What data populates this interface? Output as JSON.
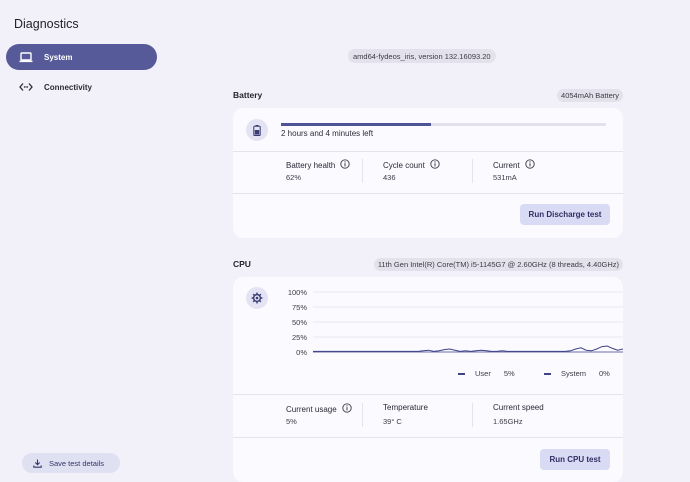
{
  "app": {
    "title": "Diagnostics"
  },
  "sidebar": {
    "items": [
      {
        "label": "System",
        "icon": "laptop-icon",
        "active": true
      },
      {
        "label": "Connectivity",
        "icon": "code-arrows-icon",
        "active": false
      }
    ],
    "save_button": "Save test details"
  },
  "system": {
    "version": "amd64-fydeos_iris, version 132.16093.20"
  },
  "battery": {
    "title": "Battery",
    "chip": "4054mAh Battery",
    "icon": "battery-icon",
    "charge_fraction": 0.46,
    "time_left": "2 hours and 4 minutes left",
    "metrics": [
      {
        "label": "Battery health",
        "value": "62%",
        "info": true
      },
      {
        "label": "Cycle count",
        "value": "436",
        "info": true
      },
      {
        "label": "Current",
        "value": "531mA",
        "info": true
      }
    ],
    "button": "Run Discharge test"
  },
  "cpu": {
    "title": "CPU",
    "chip": "11th Gen Intel(R) Core(TM) i5-1145G7 @ 2.60GHz (8 threads, 4.40GHz)",
    "icon": "settings-gear-icon",
    "legend": [
      {
        "label": "User",
        "value": "5%"
      },
      {
        "label": "System",
        "value": "0%"
      }
    ],
    "metrics": [
      {
        "label": "Current usage",
        "value": "5%",
        "info": true
      },
      {
        "label": "Temperature",
        "value": "39° C",
        "info": false
      },
      {
        "label": "Current speed",
        "value": "1.65GHz",
        "info": false
      }
    ],
    "button": "Run CPU test"
  },
  "colors": {
    "accent": "#575a98",
    "series": "#3f4287",
    "card": "#fbfaff",
    "background": "#f2f1fa"
  },
  "chart_data": {
    "type": "line",
    "ylim": [
      0,
      100
    ],
    "yticks": [
      "100%",
      "75%",
      "50%",
      "25%",
      "0%"
    ],
    "grid": true,
    "legend_position": "bottom-right",
    "series": [
      {
        "name": "User",
        "values": [
          1,
          1,
          1,
          1,
          1,
          1,
          1,
          1,
          1,
          1,
          1,
          1,
          1,
          1,
          1,
          1,
          1,
          1,
          1,
          1,
          1,
          2,
          3,
          1,
          2,
          4,
          5,
          3,
          1,
          2,
          1,
          2,
          3,
          2,
          1,
          1,
          2,
          1,
          1,
          1,
          1,
          1,
          1,
          1,
          1,
          1,
          1,
          1,
          1,
          2,
          5,
          7,
          3,
          2,
          5,
          9,
          10,
          6,
          3,
          5
        ]
      },
      {
        "name": "System",
        "values": [
          0,
          0,
          0,
          0,
          0,
          0,
          0,
          0,
          0,
          0,
          0,
          0,
          0,
          0,
          0,
          0,
          0,
          0,
          0,
          0,
          0,
          0,
          0,
          0,
          0,
          0,
          0,
          0,
          0,
          0,
          0,
          0,
          0,
          0,
          0,
          0,
          0,
          0,
          0,
          0,
          0,
          0,
          0,
          0,
          0,
          0,
          0,
          0,
          0,
          0,
          0,
          0,
          0,
          0,
          0,
          0,
          0,
          0,
          0,
          0
        ]
      }
    ]
  }
}
